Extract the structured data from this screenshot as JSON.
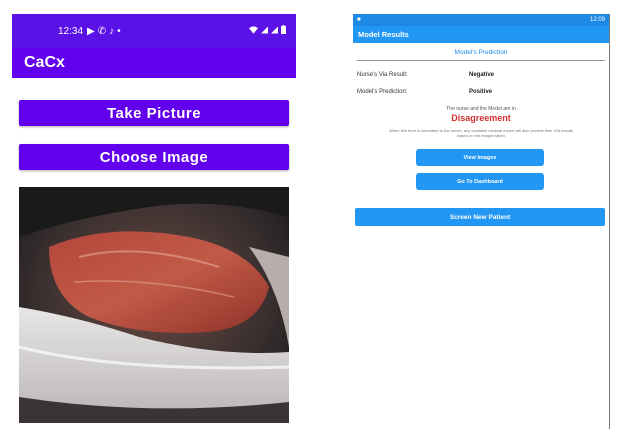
{
  "left_screen": {
    "status_bar": {
      "time": "12:34",
      "icons": [
        "play-icon",
        "whatsapp-icon",
        "tiktok-icon",
        "dot-icon"
      ],
      "system_icons": [
        "wifi-icon",
        "signal-icon",
        "signal-icon",
        "battery-icon"
      ]
    },
    "app_title": "CaCx",
    "buttons": {
      "take_picture": "Take Picture",
      "choose_image": "Choose Image"
    },
    "colors": {
      "primary": "#6200ee",
      "status_bar": "#5b12e6"
    }
  },
  "right_screen": {
    "status_bar": {
      "left_icon": "app-icon",
      "time": "12:09"
    },
    "app_title": "Model Results",
    "section_title": "Model's Prediction",
    "results": [
      {
        "label": "Nurse's Via Result:",
        "value": "Negative"
      },
      {
        "label": "Model's Prediction:",
        "value": "Positive"
      }
    ],
    "agreement_text": "The nurse and the Model are in",
    "agreement_status": "Disagreement",
    "info_text_line1": "When this form is submitted to the server, any available medical expert will also provide their VIA results",
    "info_text_line2": "based on the images taken",
    "buttons": {
      "view_images": "View Images",
      "go_to_dashboard": "Go To Dashboard",
      "screen_new_patient": "Screen New Patient"
    },
    "colors": {
      "primary": "#2196f3",
      "disagreement": "#d32f2f"
    }
  }
}
